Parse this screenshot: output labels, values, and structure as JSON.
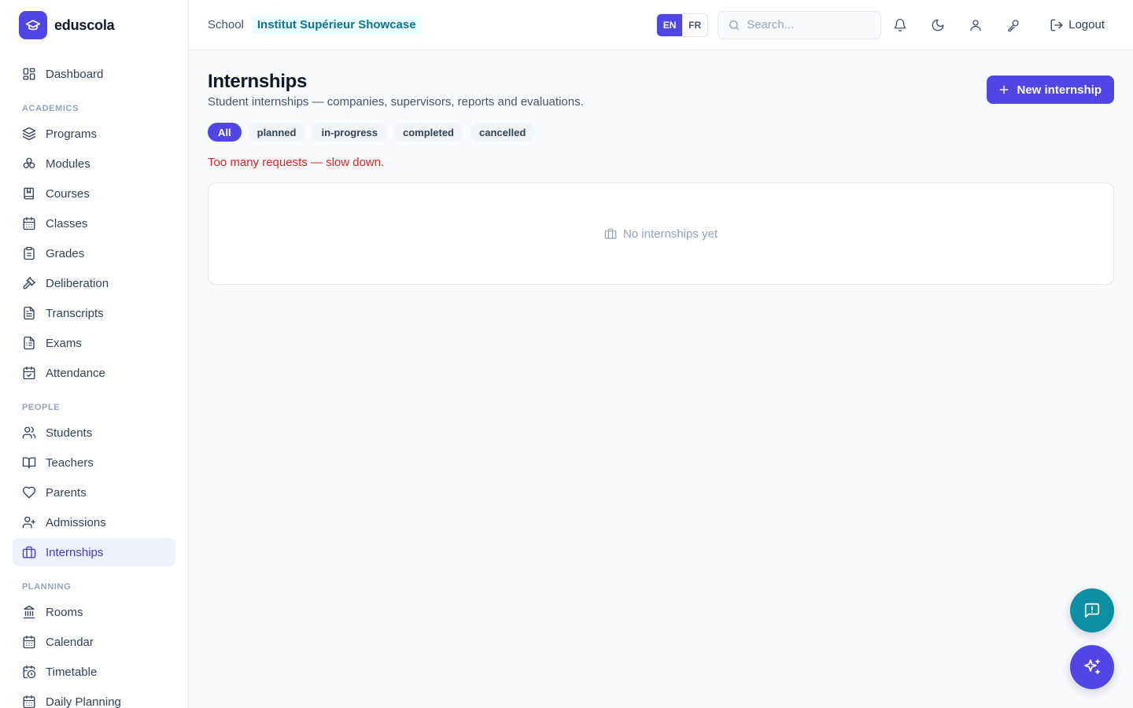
{
  "brand": {
    "name": "eduscola",
    "logo_icon": "graduation-cap-icon"
  },
  "sidebar": {
    "top": [
      {
        "label": "Dashboard",
        "icon": "dashboard-icon"
      }
    ],
    "sections": [
      {
        "title": "ACADEMICS",
        "items": [
          {
            "label": "Programs",
            "icon": "layers-icon"
          },
          {
            "label": "Modules",
            "icon": "modules-icon"
          },
          {
            "label": "Courses",
            "icon": "book-icon"
          },
          {
            "label": "Classes",
            "icon": "calendar-icon"
          },
          {
            "label": "Grades",
            "icon": "clipboard-icon"
          },
          {
            "label": "Deliberation",
            "icon": "gavel-icon"
          },
          {
            "label": "Transcripts",
            "icon": "file-text-icon"
          },
          {
            "label": "Exams",
            "icon": "file-list-icon"
          },
          {
            "label": "Attendance",
            "icon": "calendar-check-icon"
          }
        ]
      },
      {
        "title": "PEOPLE",
        "items": [
          {
            "label": "Students",
            "icon": "users-icon"
          },
          {
            "label": "Teachers",
            "icon": "open-book-icon"
          },
          {
            "label": "Parents",
            "icon": "heart-icon"
          },
          {
            "label": "Admissions",
            "icon": "user-plus-icon"
          },
          {
            "label": "Internships",
            "icon": "briefcase-icon",
            "active": true
          }
        ]
      },
      {
        "title": "PLANNING",
        "items": [
          {
            "label": "Rooms",
            "icon": "building-icon"
          },
          {
            "label": "Calendar",
            "icon": "calendar-icon"
          },
          {
            "label": "Timetable",
            "icon": "calendar-clock-icon"
          },
          {
            "label": "Daily Planning",
            "icon": "calendar-icon"
          }
        ]
      }
    ]
  },
  "topbar": {
    "school_label": "School",
    "school_name": "Institut Supérieur Showcase",
    "languages": [
      {
        "code": "EN",
        "active": true
      },
      {
        "code": "FR",
        "active": false
      }
    ],
    "search_placeholder": "Search...",
    "icons": [
      "bell-icon",
      "moon-icon",
      "user-icon",
      "key-icon"
    ],
    "logout_label": "Logout"
  },
  "page": {
    "title": "Internships",
    "subtitle": "Student internships — companies, supervisors, reports and evaluations.",
    "new_button": "New internship",
    "filters": [
      {
        "label": "All",
        "active": true
      },
      {
        "label": "planned",
        "active": false
      },
      {
        "label": "in-progress",
        "active": false
      },
      {
        "label": "completed",
        "active": false
      },
      {
        "label": "cancelled",
        "active": false
      }
    ],
    "error": "Too many requests — slow down.",
    "empty_text": "No internships yet"
  },
  "colors": {
    "accent": "#4f46e5",
    "teal": "#0e8fa3",
    "error": "#dc2626"
  }
}
